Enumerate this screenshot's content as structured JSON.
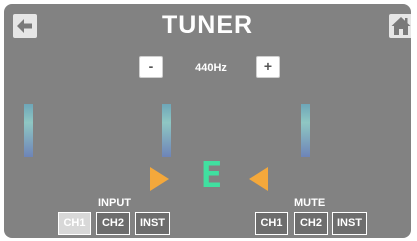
{
  "header": {
    "title": "TUNER",
    "back_icon": "back-arrow-icon",
    "home_icon": "home-icon"
  },
  "pitch": {
    "minus_label": "-",
    "value": "440Hz",
    "plus_label": "+"
  },
  "tuner": {
    "note": "E"
  },
  "input": {
    "label": "INPUT",
    "buttons": [
      "CH1",
      "CH2",
      "INST"
    ],
    "selected": "CH1"
  },
  "mute": {
    "label": "MUTE",
    "buttons": [
      "CH1",
      "CH2",
      "INST"
    ]
  },
  "colors": {
    "background": "#828282",
    "note": "#40e0a0",
    "arrows": "#f4a83b",
    "meter": "#8fc7c3"
  }
}
